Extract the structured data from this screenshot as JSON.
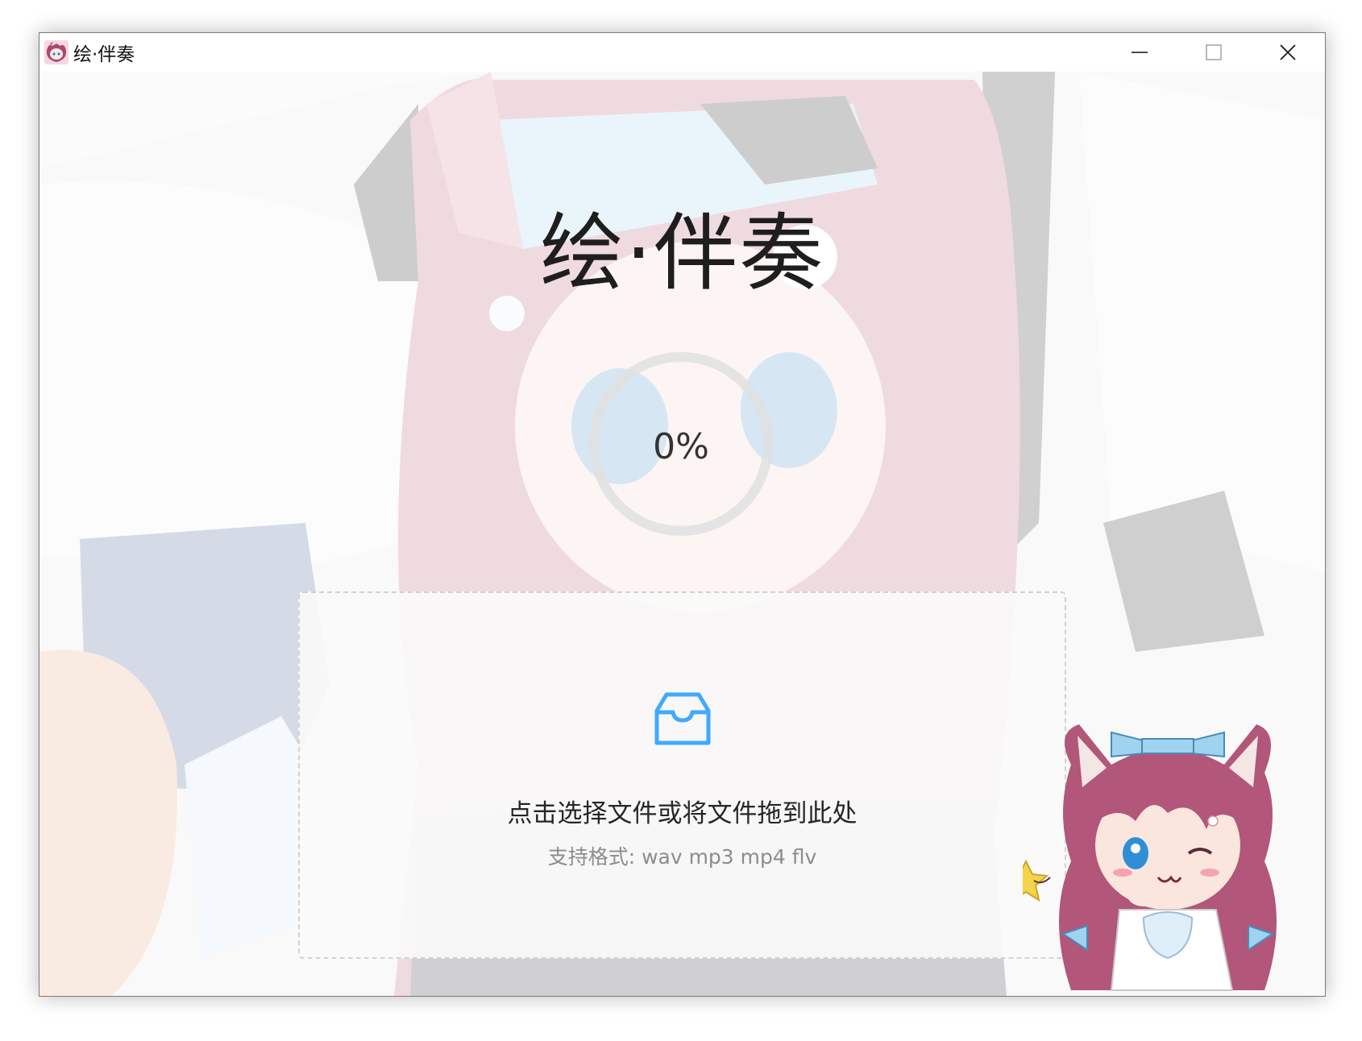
{
  "window": {
    "title": "绘·伴奏",
    "controls": {
      "minimize_icon": "minimize-icon",
      "maximize_icon": "maximize-icon",
      "close_icon": "close-icon"
    }
  },
  "main": {
    "app_title": "绘·伴奏",
    "progress": {
      "value": 0,
      "label": "0%"
    },
    "upload": {
      "icon": "inbox-icon",
      "hint": "点击选择文件或将文件拖到此处",
      "formats": "支持格式: wav mp3 mp4 flv"
    }
  },
  "colors": {
    "accent": "#40a9ff",
    "title_text": "#1e1e1e",
    "hint_text": "#262626",
    "secondary_text": "#8c8c8c",
    "dashed_border": "#d2d2d2",
    "mascot_hair": "#b2567a"
  }
}
